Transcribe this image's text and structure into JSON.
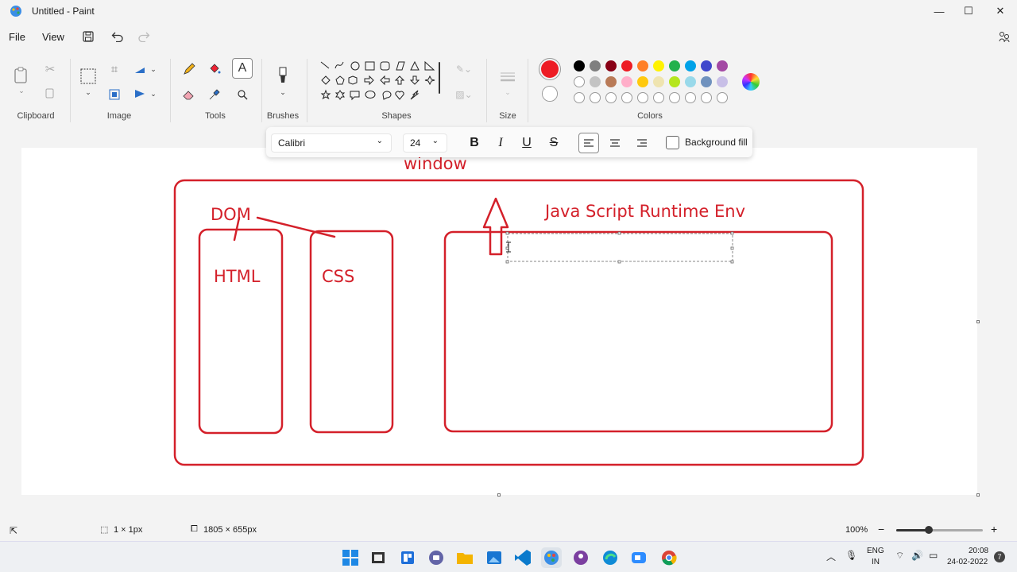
{
  "window": {
    "title": "Untitled - Paint",
    "minimize": "—",
    "maximize": "☐",
    "close": "✕"
  },
  "menu": {
    "file": "File",
    "view": "View"
  },
  "ribbon": {
    "clipboard": "Clipboard",
    "image": "Image",
    "tools": "Tools",
    "brushes": "Brushes",
    "shapes": "Shapes",
    "size": "Size",
    "colors": "Colors"
  },
  "palette": {
    "row1": [
      "#000000",
      "#7f7f7f",
      "#880015",
      "#ed1c24",
      "#ff7f27",
      "#fff200",
      "#22b14c",
      "#00a2e8",
      "#3f48cc",
      "#a349a4"
    ],
    "row2": [
      "#ffffff",
      "#c3c3c3",
      "#b97a57",
      "#ffaec9",
      "#ffc90e",
      "#efe4b0",
      "#b5e61d",
      "#99d9ea",
      "#7092be",
      "#c8bfe7"
    ],
    "primary": "#ed1c24",
    "secondary": "#ffffff"
  },
  "text_toolbar": {
    "font": "Calibri",
    "size": "24",
    "bold": "B",
    "italic": "I",
    "underline": "U",
    "strike": "S",
    "background_fill": "Background fill"
  },
  "drawing": {
    "window": "window",
    "dom": "DOM",
    "html": "HTML",
    "css": "CSS",
    "runtime": "Java Script Runtime Env",
    "stroke_color": "#d4202a"
  },
  "status": {
    "selection": "1 × 1px",
    "canvas_size": "1805 × 655px",
    "zoom": "100%"
  },
  "taskbar": {
    "lang1": "ENG",
    "lang2": "IN",
    "time": "20:08",
    "date": "24-02-2022",
    "notif": "7"
  }
}
